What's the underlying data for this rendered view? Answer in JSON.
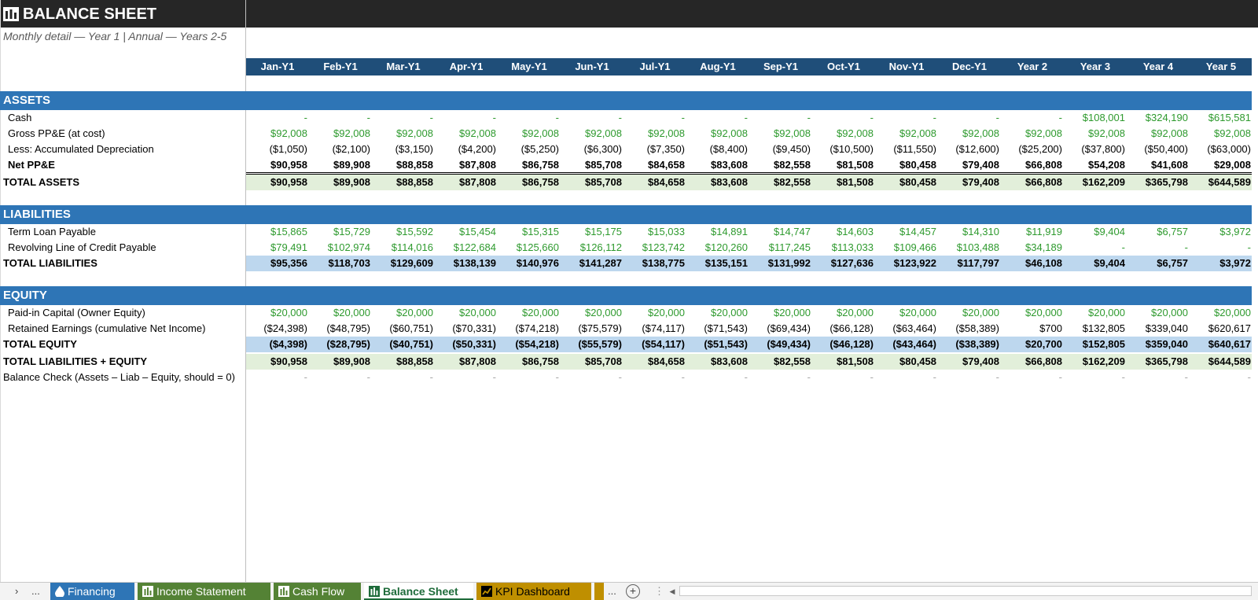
{
  "sheet": {
    "title": "BALANCE SHEET",
    "subtitle": "Monthly detail — Year 1  |  Annual — Years 2-5"
  },
  "columns": [
    "Jan-Y1",
    "Feb-Y1",
    "Mar-Y1",
    "Apr-Y1",
    "May-Y1",
    "Jun-Y1",
    "Jul-Y1",
    "Aug-Y1",
    "Sep-Y1",
    "Oct-Y1",
    "Nov-Y1",
    "Dec-Y1",
    "Year 2",
    "Year 3",
    "Year 4",
    "Year 5"
  ],
  "sections": {
    "assets": "ASSETS",
    "liabilities": "LIABILITIES",
    "equity": "EQUITY"
  },
  "rows": {
    "cash": {
      "label": "Cash",
      "values": [
        "-",
        "-",
        "-",
        "-",
        "-",
        "-",
        "-",
        "-",
        "-",
        "-",
        "-",
        "-",
        "-",
        "$108,001",
        "$324,190",
        "$615,581"
      ]
    },
    "gross_ppe": {
      "label": "Gross PP&E (at cost)",
      "values": [
        "$92,008",
        "$92,008",
        "$92,008",
        "$92,008",
        "$92,008",
        "$92,008",
        "$92,008",
        "$92,008",
        "$92,008",
        "$92,008",
        "$92,008",
        "$92,008",
        "$92,008",
        "$92,008",
        "$92,008",
        "$92,008"
      ]
    },
    "accum_dep": {
      "label": "Less: Accumulated Depreciation",
      "values": [
        "($1,050)",
        "($2,100)",
        "($3,150)",
        "($4,200)",
        "($5,250)",
        "($6,300)",
        "($7,350)",
        "($8,400)",
        "($9,450)",
        "($10,500)",
        "($11,550)",
        "($12,600)",
        "($25,200)",
        "($37,800)",
        "($50,400)",
        "($63,000)"
      ]
    },
    "net_ppe": {
      "label": "Net PP&E",
      "values": [
        "$90,958",
        "$89,908",
        "$88,858",
        "$87,808",
        "$86,758",
        "$85,708",
        "$84,658",
        "$83,608",
        "$82,558",
        "$81,508",
        "$80,458",
        "$79,408",
        "$66,808",
        "$54,208",
        "$41,608",
        "$29,008"
      ]
    },
    "total_assets": {
      "label": "TOTAL ASSETS",
      "values": [
        "$90,958",
        "$89,908",
        "$88,858",
        "$87,808",
        "$86,758",
        "$85,708",
        "$84,658",
        "$83,608",
        "$82,558",
        "$81,508",
        "$80,458",
        "$79,408",
        "$66,808",
        "$162,209",
        "$365,798",
        "$644,589"
      ]
    },
    "term_loan": {
      "label": "Term Loan Payable",
      "values": [
        "$15,865",
        "$15,729",
        "$15,592",
        "$15,454",
        "$15,315",
        "$15,175",
        "$15,033",
        "$14,891",
        "$14,747",
        "$14,603",
        "$14,457",
        "$14,310",
        "$11,919",
        "$9,404",
        "$6,757",
        "$3,972"
      ]
    },
    "revolver": {
      "label": "Revolving Line of Credit Payable",
      "values": [
        "$79,491",
        "$102,974",
        "$114,016",
        "$122,684",
        "$125,660",
        "$126,112",
        "$123,742",
        "$120,260",
        "$117,245",
        "$113,033",
        "$109,466",
        "$103,488",
        "$34,189",
        "-",
        "-",
        "-"
      ]
    },
    "total_liabilities": {
      "label": "TOTAL LIABILITIES",
      "values": [
        "$95,356",
        "$118,703",
        "$129,609",
        "$138,139",
        "$140,976",
        "$141,287",
        "$138,775",
        "$135,151",
        "$131,992",
        "$127,636",
        "$123,922",
        "$117,797",
        "$46,108",
        "$9,404",
        "$6,757",
        "$3,972"
      ]
    },
    "paid_in_capital": {
      "label": "Paid-in Capital (Owner Equity)",
      "values": [
        "$20,000",
        "$20,000",
        "$20,000",
        "$20,000",
        "$20,000",
        "$20,000",
        "$20,000",
        "$20,000",
        "$20,000",
        "$20,000",
        "$20,000",
        "$20,000",
        "$20,000",
        "$20,000",
        "$20,000",
        "$20,000"
      ]
    },
    "retained_earnings": {
      "label": "Retained Earnings (cumulative Net Income)",
      "values": [
        "($24,398)",
        "($48,795)",
        "($60,751)",
        "($70,331)",
        "($74,218)",
        "($75,579)",
        "($74,117)",
        "($71,543)",
        "($69,434)",
        "($66,128)",
        "($63,464)",
        "($58,389)",
        "$700",
        "$132,805",
        "$339,040",
        "$620,617"
      ]
    },
    "total_equity": {
      "label": "TOTAL EQUITY",
      "values": [
        "($4,398)",
        "($28,795)",
        "($40,751)",
        "($50,331)",
        "($54,218)",
        "($55,579)",
        "($54,117)",
        "($51,543)",
        "($49,434)",
        "($46,128)",
        "($43,464)",
        "($38,389)",
        "$20,700",
        "$152,805",
        "$359,040",
        "$640,617"
      ]
    },
    "total_liab_equity": {
      "label": "TOTAL LIABILITIES + EQUITY",
      "values": [
        "$90,958",
        "$89,908",
        "$88,858",
        "$87,808",
        "$86,758",
        "$85,708",
        "$84,658",
        "$83,608",
        "$82,558",
        "$81,508",
        "$80,458",
        "$79,408",
        "$66,808",
        "$162,209",
        "$365,798",
        "$644,589"
      ]
    },
    "balance_check": {
      "label": "Balance Check (Assets – Liab – Equity, should = 0)",
      "values": [
        "-",
        "-",
        "-",
        "-",
        "-",
        "-",
        "-",
        "-",
        "-",
        "-",
        "-",
        "-",
        "-",
        "-",
        "-",
        "-"
      ]
    }
  },
  "tabs": {
    "nav_next": "›",
    "nav_more_left": "...",
    "items": [
      {
        "label": "Financing",
        "color": "#2e75b6",
        "text_color": "#ffffff",
        "icon": "drop-icon"
      },
      {
        "label": "Income Statement",
        "color": "#548235",
        "text_color": "#ffffff",
        "icon": "bar-chart-icon"
      },
      {
        "label": "Cash Flow",
        "color": "#548235",
        "text_color": "#ffffff",
        "icon": "bar-chart-icon"
      },
      {
        "label": "Balance Sheet",
        "color": "#ffffff",
        "text_color": "#1e6b3a",
        "icon": "bar-chart-icon",
        "active": true
      },
      {
        "label": "KPI Dashboard",
        "color": "#bf8f00",
        "text_color": "#000000",
        "icon": "trend-chart-icon"
      }
    ],
    "nav_more_right": "...",
    "add_sheet": "+",
    "scroll_left": "◀"
  },
  "colors": {
    "title_bar": "#262626",
    "header_row": "#1f4e79",
    "section_band": "#2e75b6",
    "input_green": "#2e9a2e",
    "total_green_fill": "#e2efda",
    "total_blue_fill": "#bdd7ee"
  }
}
